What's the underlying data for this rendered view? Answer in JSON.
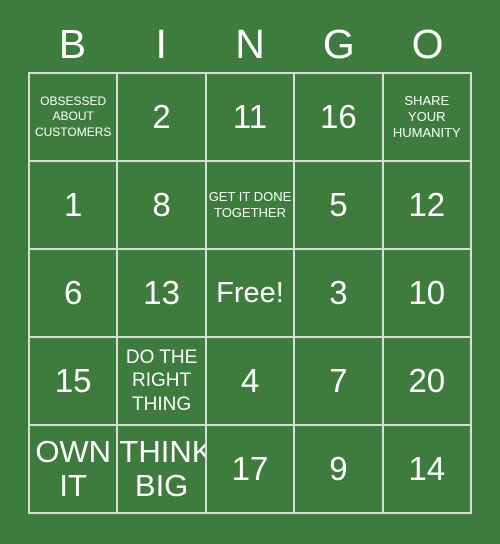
{
  "card": {
    "title_letters": [
      "B",
      "I",
      "N",
      "G",
      "O"
    ],
    "background_color": "#3d7c3d",
    "text_color": "#ffffff",
    "grid_line_color": "#d8dcd8",
    "rows": [
      [
        {
          "text": "OBSESSED ABOUT CUSTOMERS",
          "size": "xs",
          "kind": "phrase"
        },
        {
          "text": "2",
          "size": "num",
          "kind": "number"
        },
        {
          "text": "11",
          "size": "num",
          "kind": "number"
        },
        {
          "text": "16",
          "size": "num",
          "kind": "number"
        },
        {
          "text": "SHARE YOUR HUMANITY",
          "size": "sm",
          "kind": "phrase"
        }
      ],
      [
        {
          "text": "1",
          "size": "num",
          "kind": "number"
        },
        {
          "text": "8",
          "size": "num",
          "kind": "number"
        },
        {
          "text": "GET IT DONE TOGETHER",
          "size": "sm",
          "kind": "phrase"
        },
        {
          "text": "5",
          "size": "num",
          "kind": "number"
        },
        {
          "text": "12",
          "size": "num",
          "kind": "number"
        }
      ],
      [
        {
          "text": "6",
          "size": "num",
          "kind": "number"
        },
        {
          "text": "13",
          "size": "num",
          "kind": "number"
        },
        {
          "text": "Free!",
          "size": "free",
          "kind": "free"
        },
        {
          "text": "3",
          "size": "num",
          "kind": "number"
        },
        {
          "text": "10",
          "size": "num",
          "kind": "number"
        }
      ],
      [
        {
          "text": "15",
          "size": "num",
          "kind": "number"
        },
        {
          "text": "DO THE RIGHT THING",
          "size": "md",
          "kind": "phrase"
        },
        {
          "text": "4",
          "size": "num",
          "kind": "number"
        },
        {
          "text": "7",
          "size": "num",
          "kind": "number"
        },
        {
          "text": "20",
          "size": "num",
          "kind": "number"
        }
      ],
      [
        {
          "text": "OWN IT",
          "size": "xl",
          "kind": "phrase"
        },
        {
          "text": "THINK BIG",
          "size": "xl",
          "kind": "phrase"
        },
        {
          "text": "17",
          "size": "num",
          "kind": "number"
        },
        {
          "text": "9",
          "size": "num",
          "kind": "number"
        },
        {
          "text": "14",
          "size": "num",
          "kind": "number"
        }
      ]
    ]
  }
}
